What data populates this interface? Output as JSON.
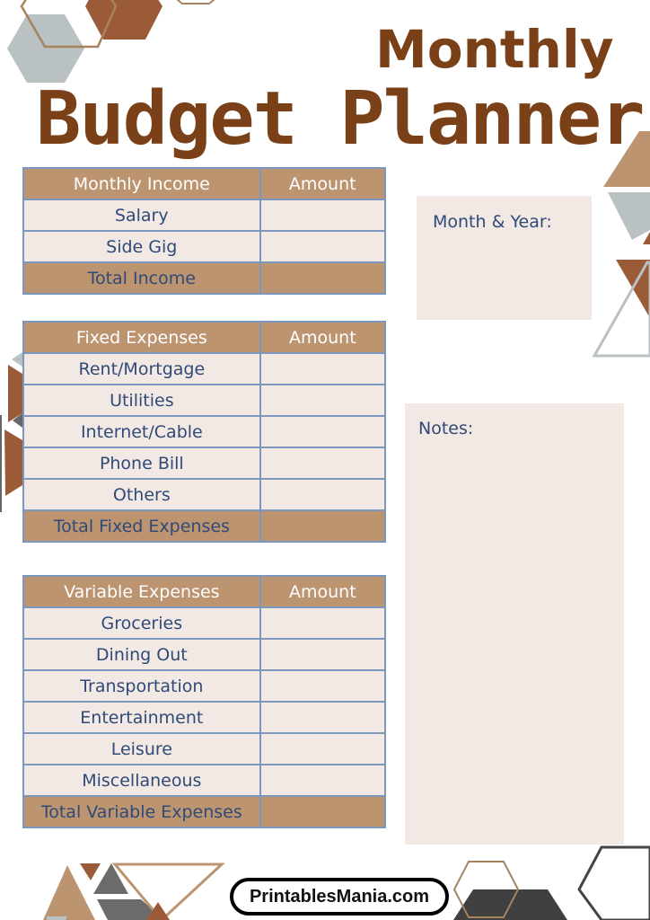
{
  "title": {
    "line1": "Monthly",
    "line2": "Budget Planner"
  },
  "colors": {
    "title_brown": "#7a4118",
    "header_tan": "#bc9470",
    "cell_cream": "#f2e9e4",
    "grid_blue": "#7b97bd",
    "text_navy": "#2f4a78",
    "rust": "#9c5b38",
    "slate_gray": "#b9c1c3",
    "charcoal": "#454545"
  },
  "income_table": {
    "header_label": "Monthly Income",
    "header_amount": "Amount",
    "rows": [
      {
        "label": "Salary",
        "amount": ""
      },
      {
        "label": "Side Gig",
        "amount": ""
      }
    ],
    "total_label": "Total Income",
    "total_amount": ""
  },
  "fixed_table": {
    "header_label": "Fixed Expenses",
    "header_amount": "Amount",
    "rows": [
      {
        "label": "Rent/Mortgage",
        "amount": ""
      },
      {
        "label": "Utilities",
        "amount": ""
      },
      {
        "label": "Internet/Cable",
        "amount": ""
      },
      {
        "label": "Phone Bill",
        "amount": ""
      },
      {
        "label": "Others",
        "amount": ""
      }
    ],
    "total_label": "Total Fixed Expenses",
    "total_amount": ""
  },
  "variable_table": {
    "header_label": "Variable Expenses",
    "header_amount": "Amount",
    "rows": [
      {
        "label": "Groceries",
        "amount": ""
      },
      {
        "label": "Dining Out",
        "amount": ""
      },
      {
        "label": "Transportation",
        "amount": ""
      },
      {
        "label": "Entertainment",
        "amount": ""
      },
      {
        "label": "Leisure",
        "amount": ""
      },
      {
        "label": "Miscellaneous",
        "amount": ""
      }
    ],
    "total_label": "Total Variable Expenses",
    "total_amount": ""
  },
  "month_year": {
    "label": "Month & Year:",
    "value": ""
  },
  "notes": {
    "label": "Notes:",
    "value": ""
  },
  "footer": {
    "brand": "PrintablesMania.com"
  }
}
